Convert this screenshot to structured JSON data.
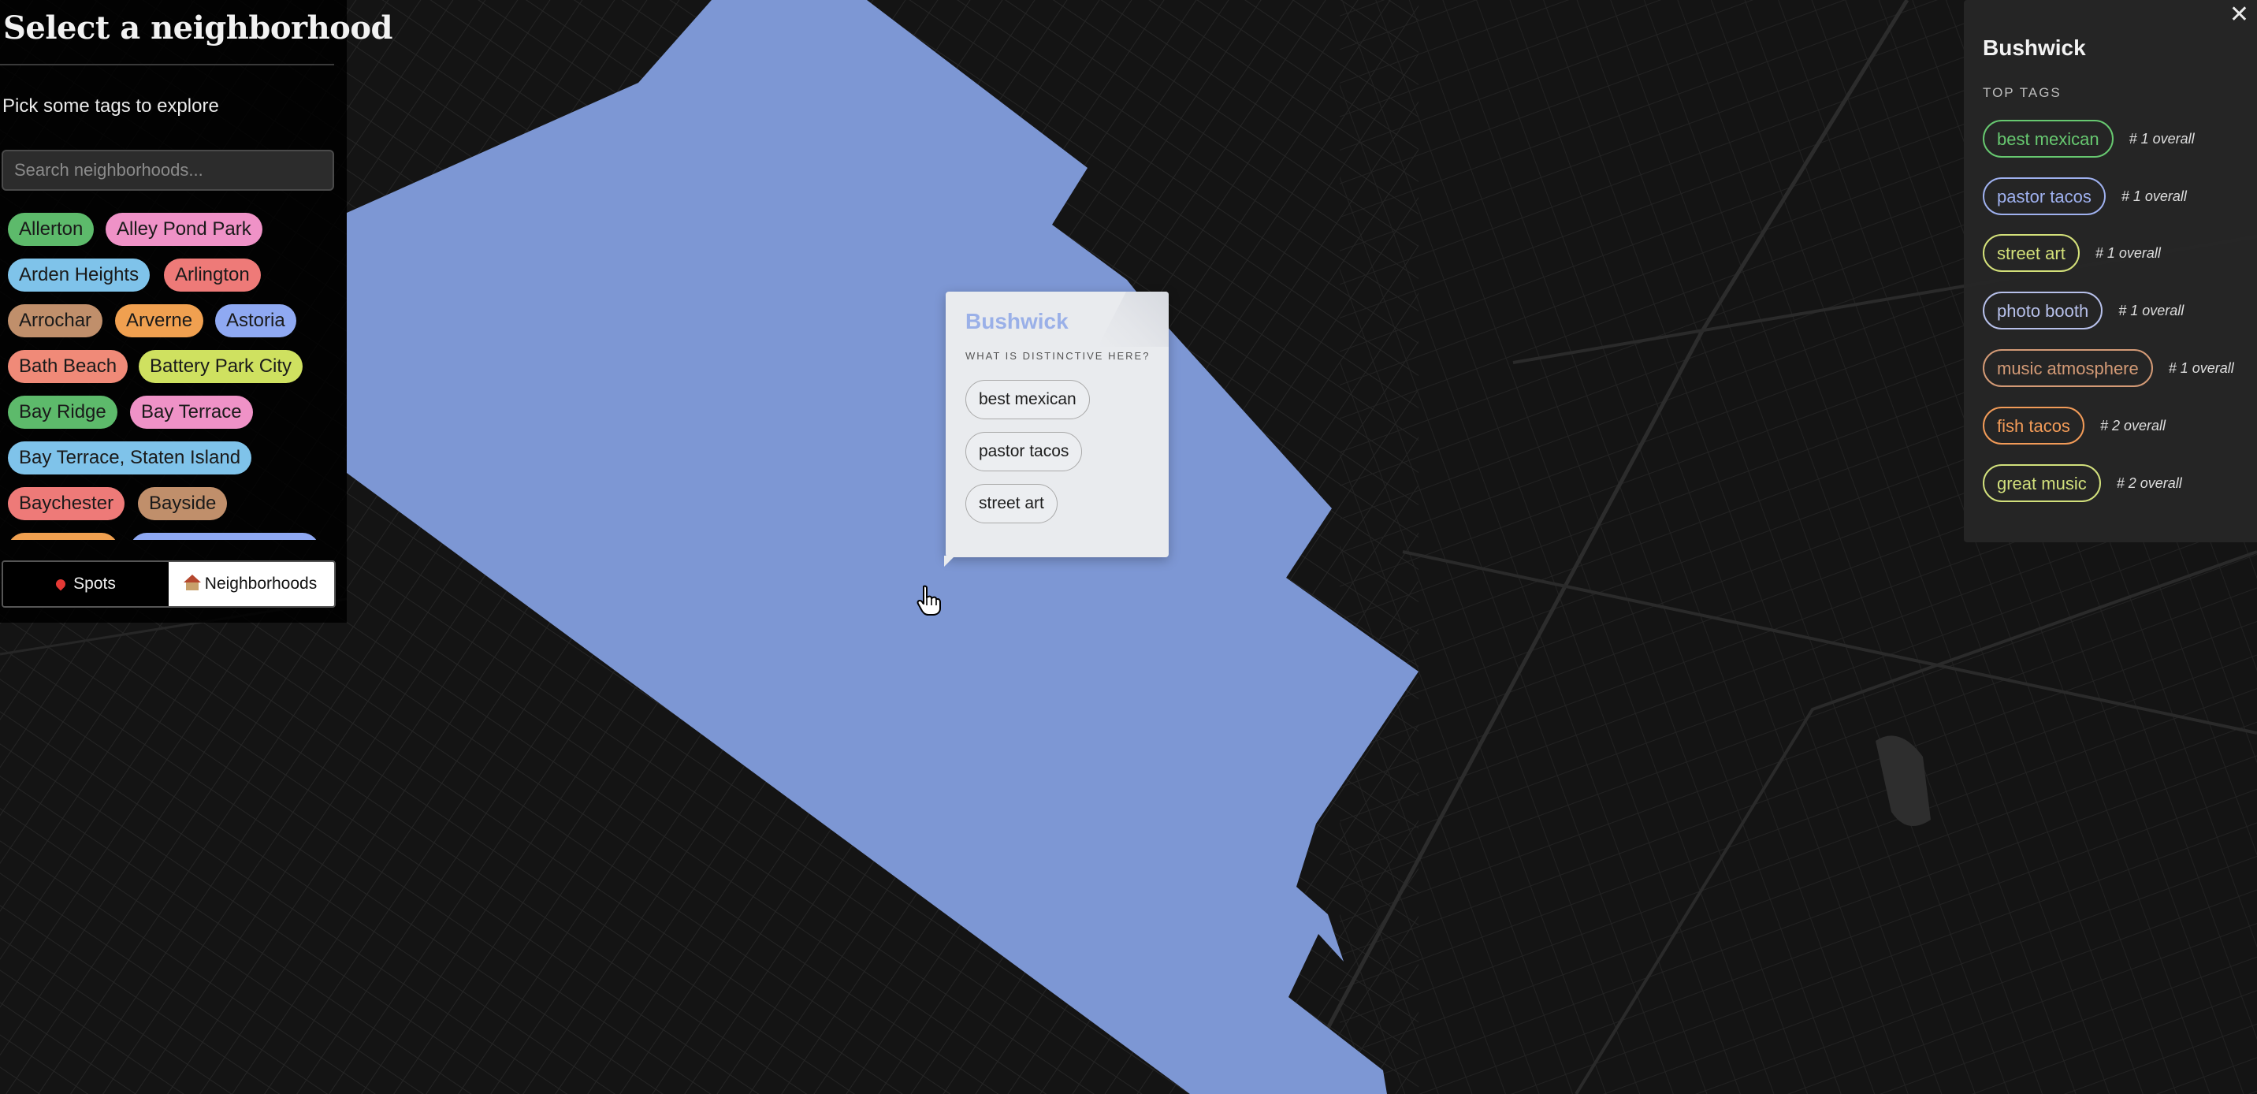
{
  "left_panel": {
    "title": "Select a neighborhood",
    "subtitle": "Pick some tags to explore",
    "search_placeholder": "Search neighborhoods...",
    "neighborhoods": [
      {
        "label": "Allerton",
        "color": "#5dba6b"
      },
      {
        "label": "Alley Pond Park",
        "color": "#ef92c7"
      },
      {
        "label": "Arden Heights",
        "color": "#7fc3ea"
      },
      {
        "label": "Arlington",
        "color": "#ee7a78"
      },
      {
        "label": "Arrochar",
        "color": "#c08f6b"
      },
      {
        "label": "Arverne",
        "color": "#f0a050"
      },
      {
        "label": "Astoria",
        "color": "#8fa9f2"
      },
      {
        "label": "Bath Beach",
        "color": "#f08a78"
      },
      {
        "label": "Battery Park City",
        "color": "#cfe160"
      },
      {
        "label": "Bay Ridge",
        "color": "#5dba6b"
      },
      {
        "label": "Bay Terrace",
        "color": "#ef92c7"
      },
      {
        "label": "Bay Terrace, Staten Island",
        "color": "#7fc3ea"
      },
      {
        "label": "Baychester",
        "color": "#ee7a78"
      },
      {
        "label": "Bayside",
        "color": "#c08f6b"
      }
    ],
    "mode_toggle": {
      "spots_label": "Spots",
      "neighborhoods_label": "Neighborhoods",
      "active": "Neighborhoods"
    }
  },
  "map_popup": {
    "title": "Bushwick",
    "subtitle": "WHAT IS DISTINCTIVE HERE?",
    "tags": [
      "best mexican",
      "pastor tacos",
      "street art"
    ]
  },
  "right_panel": {
    "title": "Bushwick",
    "subtitle": "TOP TAGS",
    "close_label": "✕",
    "tags": [
      {
        "label": "best mexican",
        "rank": "# 1 overall",
        "color": "#67c870"
      },
      {
        "label": "pastor tacos",
        "rank": "# 1 overall",
        "color": "#9fb1ef"
      },
      {
        "label": "street art",
        "rank": "# 1 overall",
        "color": "#d4e17a"
      },
      {
        "label": "photo booth",
        "rank": "# 1 overall",
        "color": "#b7c0ea"
      },
      {
        "label": "music atmosphere",
        "rank": "# 1 overall",
        "color": "#d39a76"
      },
      {
        "label": "fish tacos",
        "rank": "# 2 overall",
        "color": "#f29b58"
      },
      {
        "label": "great music",
        "rank": "# 2 overall",
        "color": "#d2e07c"
      }
    ]
  },
  "map": {
    "selected_area_color": "#7d97d4",
    "background_color": "#141414"
  }
}
